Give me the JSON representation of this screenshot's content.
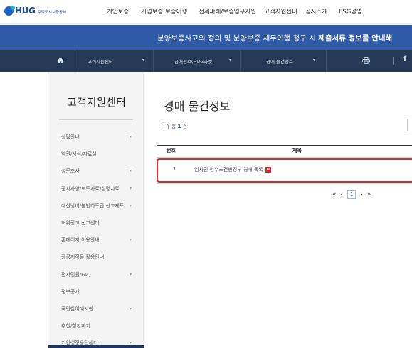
{
  "logo": {
    "text": "HUG",
    "sub": "주택도시보증공사"
  },
  "menu": [
    "개인보증",
    "기업보증",
    "보증이행",
    "전세피해/보증업무지원",
    "고객지원센터",
    "공사소개",
    "ESG경영"
  ],
  "banner": {
    "prefix": "분양보증사고의 정의 및 분양보증 채무이행 청구 시 ",
    "bold": "제출서류 정보를 안내해"
  },
  "breadcrumb": [
    "고객지원센터",
    "공매정보(HUG마켓)",
    "경매 물건정보"
  ],
  "facebook_label": "f",
  "sidebar": {
    "title": "고객지원센터",
    "items": [
      {
        "label": "상담안내",
        "chevron": true
      },
      {
        "label": "약관/서식/자료실",
        "chevron": false
      },
      {
        "label": "설문조사",
        "chevron": true
      },
      {
        "label": "공지사항/보도자료/설명자료",
        "chevron": true
      },
      {
        "label": "예산낭비/불법하도급 신고제도",
        "chevron": true
      },
      {
        "label": "허위광고 신고센터",
        "chevron": false
      },
      {
        "label": "홈페이지 이용안내",
        "chevron": true
      },
      {
        "label": "공공저작물 활용안내",
        "chevron": false
      },
      {
        "label": "전자민원/FAQ",
        "chevron": true
      },
      {
        "label": "정보공개",
        "chevron": false
      },
      {
        "label": "국민참여예시판",
        "chevron": true
      },
      {
        "label": "추천/칭찬하기",
        "chevron": false
      },
      {
        "label": "기업성장응답센터",
        "chevron": true
      }
    ]
  },
  "main": {
    "title": "경매 물건정보",
    "count_prefix": "총",
    "count_value": "1",
    "count_suffix": "건",
    "columns": {
      "num": "번호",
      "title": "제목"
    },
    "rows": [
      {
        "num": "1",
        "title": "임차권 인수조건변경부 경매 목록",
        "badge": "N"
      }
    ],
    "pager": {
      "first": "«",
      "prev": "‹",
      "current": "1",
      "next": "›",
      "last": "»"
    }
  },
  "colors": {
    "brand_blue": "#2f5aa8",
    "subnav": "#243a57",
    "highlight_red": "#e3262a"
  }
}
